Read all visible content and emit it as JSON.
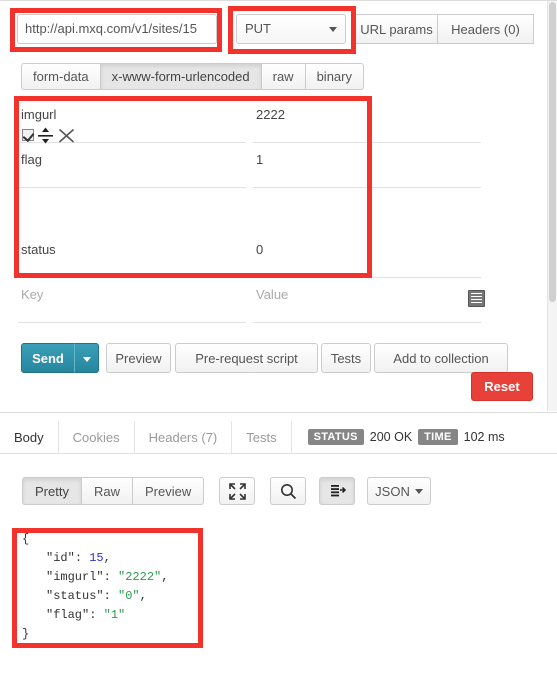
{
  "request": {
    "url": "http://api.mxq.com/v1/sites/15",
    "method": "PUT",
    "url_params_label": "URL params",
    "headers_label": "Headers (0)",
    "body_tabs": [
      {
        "label": "form-data",
        "active": false
      },
      {
        "label": "x-www-form-urlencoded",
        "active": true
      },
      {
        "label": "raw",
        "active": false
      },
      {
        "label": "binary",
        "active": false
      }
    ],
    "form_rows": [
      {
        "key": "imgurl",
        "value": "2222",
        "tools": false
      },
      {
        "key": "flag",
        "value": "1",
        "tools": true
      },
      {
        "key": "status",
        "value": "0",
        "tools": false
      }
    ],
    "new_row": {
      "key_placeholder": "Key",
      "value_placeholder": "Value"
    }
  },
  "actions": {
    "send_label": "Send",
    "preview_label": "Preview",
    "prerequest_label": "Pre-request script",
    "tests_label": "Tests",
    "add_to_collection_label": "Add to collection",
    "reset_label": "Reset"
  },
  "response": {
    "tabs": [
      {
        "label": "Body",
        "active": true
      },
      {
        "label": "Cookies",
        "active": false
      },
      {
        "label": "Headers (7)",
        "active": false
      },
      {
        "label": "Tests",
        "active": false
      }
    ],
    "status_badge": "STATUS",
    "status_value": "200 OK",
    "time_badge": "TIME",
    "time_value": "102 ms",
    "view_tabs": [
      {
        "label": "Pretty",
        "active": true
      },
      {
        "label": "Raw",
        "active": false
      },
      {
        "label": "Preview",
        "active": false
      }
    ],
    "format_label": "JSON",
    "body_lines": [
      {
        "indent": 0,
        "segments": [
          {
            "text": "{",
            "cls": "jpunc"
          }
        ]
      },
      {
        "indent": 1,
        "segments": [
          {
            "text": "\"id\"",
            "cls": "jkey"
          },
          {
            "text": ": ",
            "cls": "jpunc"
          },
          {
            "text": "15",
            "cls": "jnum"
          },
          {
            "text": ",",
            "cls": "jpunc"
          }
        ]
      },
      {
        "indent": 1,
        "segments": [
          {
            "text": "\"imgurl\"",
            "cls": "jkey"
          },
          {
            "text": ": ",
            "cls": "jpunc"
          },
          {
            "text": "\"2222\"",
            "cls": "jstr"
          },
          {
            "text": ",",
            "cls": "jpunc"
          }
        ]
      },
      {
        "indent": 1,
        "segments": [
          {
            "text": "\"status\"",
            "cls": "jkey"
          },
          {
            "text": ": ",
            "cls": "jpunc"
          },
          {
            "text": "\"0\"",
            "cls": "jstr"
          },
          {
            "text": ",",
            "cls": "jpunc"
          }
        ]
      },
      {
        "indent": 1,
        "segments": [
          {
            "text": "\"flag\"",
            "cls": "jkey"
          },
          {
            "text": ": ",
            "cls": "jpunc"
          },
          {
            "text": "\"1\"",
            "cls": "jstr"
          }
        ]
      },
      {
        "indent": 0,
        "segments": [
          {
            "text": "}",
            "cls": "jpunc"
          }
        ]
      }
    ]
  },
  "colors": {
    "annotation": "#f3322c",
    "send": "#2a8fa8",
    "reset": "#e8413a",
    "badge": "#868686",
    "json_string": "#2a9d4a",
    "json_number": "#3333cc"
  }
}
